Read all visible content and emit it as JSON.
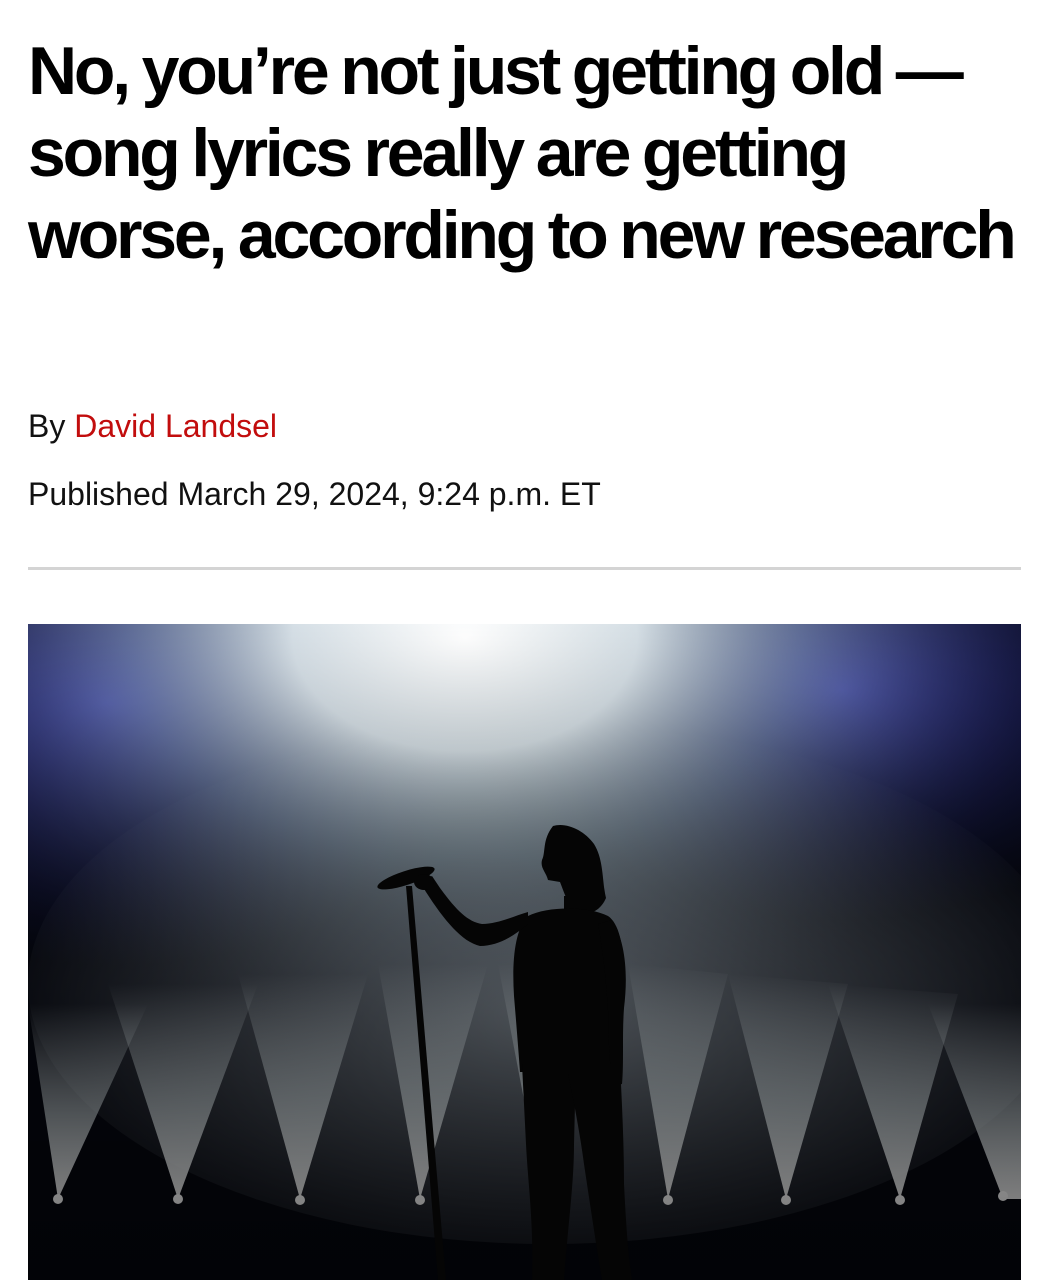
{
  "article": {
    "headline": "No, you’re not just getting old — song lyrics really are getting worse, according to new research",
    "byline_prefix": "By",
    "author": "David Landsel",
    "published": "Published March 29, 2024, 9:24 p.m. ET"
  },
  "hero_image": {
    "subject": "silhouette of a singer at a microphone stand on a stage with spotlights and smoke"
  },
  "colors": {
    "author_link": "#c20d0d",
    "divider": "#d4d4d4",
    "stage_blue": "#3b3dc8"
  }
}
